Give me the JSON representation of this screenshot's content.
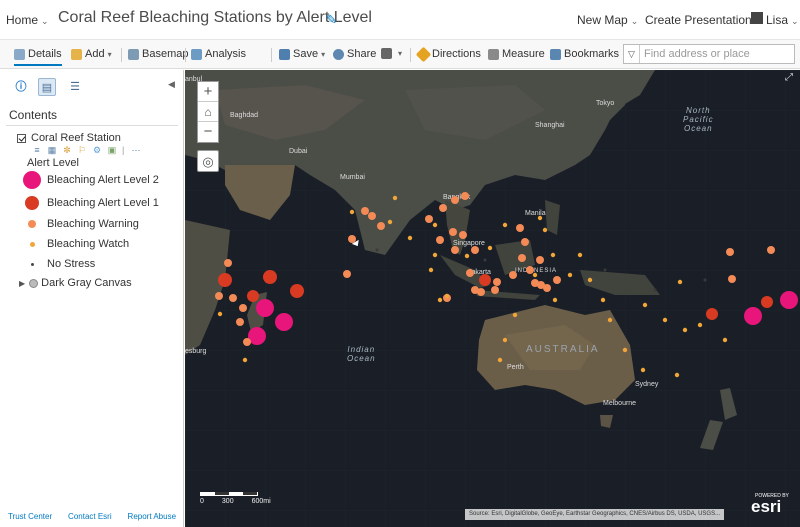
{
  "header": {
    "home_label": "Home",
    "map_title": "Coral Reef Bleaching Stations by Alert Level",
    "new_map": "New Map",
    "create_presentation": "Create Presentation",
    "user": "Lisa"
  },
  "toolbar": {
    "details": "Details",
    "add": "Add",
    "basemap": "Basemap",
    "analysis": "Analysis",
    "save": "Save",
    "share": "Share",
    "directions": "Directions",
    "measure": "Measure",
    "bookmarks": "Bookmarks",
    "search_placeholder": "Find address or place"
  },
  "sidebar": {
    "contents_title": "Contents",
    "layer_name": "Coral Reef Station",
    "legend_title": "Alert Level",
    "legend": [
      {
        "label": "Bleaching Alert Level 2",
        "color": "#e8157a"
      },
      {
        "label": "Bleaching Alert Level 1",
        "color": "#d83a22"
      },
      {
        "label": "Bleaching Warning",
        "color": "#f48a56"
      },
      {
        "label": "Bleaching Watch",
        "color": "#f2a638"
      },
      {
        "label": "No Stress",
        "color": "#4a4a4a"
      }
    ],
    "basemap_layer": "Dark Gray Canvas",
    "footer": {
      "trust": "Trust Center",
      "contact": "Contact Esri",
      "report": "Report Abuse"
    }
  },
  "map": {
    "labels": {
      "istanbul": "anbul",
      "tokyo": "Tokyo",
      "baghdad": "Baghdad",
      "shanghai": "Shanghai",
      "dubai": "Dubai",
      "north_pacific": "North",
      "north_pacific2": "Pacific",
      "north_pacific3": "Ocean",
      "mumbai": "Mumbai",
      "bangkok": "Bangkok",
      "manila": "Manila",
      "singapore": "Singapore",
      "jakarta": "Jakarta",
      "indonesia": "INDONESIA",
      "indian": "Indian",
      "indian2": "Ocean",
      "australia": "AUSTRALIA",
      "perth": "Perth",
      "sydney": "Sydney",
      "melbourne": "Melbourne",
      "johannesburg": "esburg"
    },
    "scale_labels": [
      "0",
      "300",
      "600mi"
    ],
    "attribution": "Source: Esri, DigitalGlobe, GeoEye, Earthstar Geographics, CNES/Airbus DS, USDA, USGS...",
    "esri_powered": "POWERED BY",
    "esri_logo": "esri"
  }
}
